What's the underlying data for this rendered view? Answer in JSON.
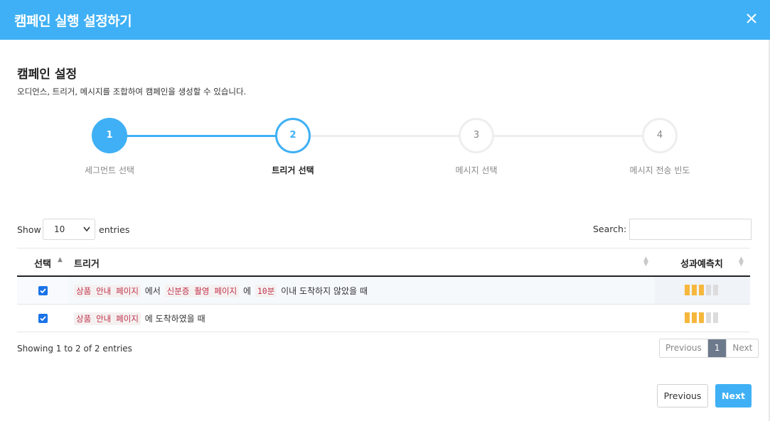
{
  "header": {
    "title": "캠페인 실행 설정하기",
    "close_icon": "close-icon"
  },
  "section": {
    "title": "캠페인 설정",
    "description": "오디언스, 트리거, 메시지를 조합하여 캠페인을 생성할 수 있습니다."
  },
  "steps": [
    {
      "number": "1",
      "label": "세그먼트 선택",
      "state": "done"
    },
    {
      "number": "2",
      "label": "트리거 선택",
      "state": "active"
    },
    {
      "number": "3",
      "label": "메시지 선택",
      "state": "todo"
    },
    {
      "number": "4",
      "label": "메시지 전송 빈도",
      "state": "todo"
    }
  ],
  "table_controls": {
    "show_label": "Show",
    "page_size": "10",
    "entries_label": "entries",
    "search_label": "Search:",
    "search_value": ""
  },
  "table": {
    "columns": [
      "선택",
      "트리거",
      "성과예측치"
    ],
    "rows": [
      {
        "checked": true,
        "trigger_parts": [
          {
            "text": "상품 안내 페이지",
            "chip": true
          },
          {
            "text": "에서",
            "chip": false
          },
          {
            "text": "신분증 촬영 페이지",
            "chip": true
          },
          {
            "text": "에",
            "chip": false
          },
          {
            "text": "10분",
            "chip": true
          },
          {
            "text": "이내 도착하지 않았을 때",
            "chip": false
          }
        ],
        "score": {
          "value": 3,
          "max": 5
        }
      },
      {
        "checked": true,
        "trigger_parts": [
          {
            "text": "상품 안내 페이지",
            "chip": true
          },
          {
            "text": "에 도착하였을 때",
            "chip": false
          }
        ],
        "score": {
          "value": 3,
          "max": 5
        }
      }
    ]
  },
  "footer": {
    "info": "Showing 1 to 2 of 2 entries",
    "pagination": {
      "previous": "Previous",
      "current": "1",
      "next": "Next"
    }
  },
  "actions": {
    "previous": "Previous",
    "next": "Next"
  },
  "colors": {
    "accent": "#3fb0f5",
    "chip_text": "#c0324a",
    "score_on": "#f6b73c",
    "score_off": "#dcdcdc"
  }
}
